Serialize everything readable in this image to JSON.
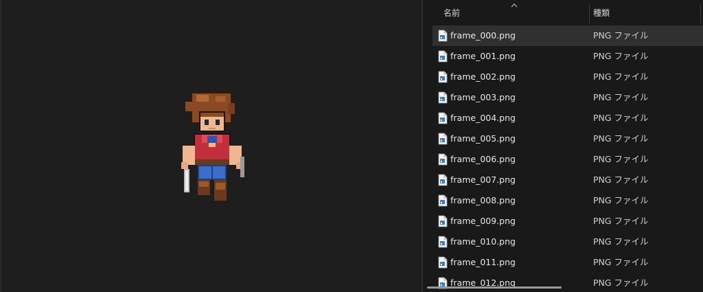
{
  "explorer": {
    "columns": {
      "name": "名前",
      "type": "種類"
    },
    "sort_icon": "chevron-up-icon",
    "file_icon": "png-file-icon",
    "files": [
      {
        "name": "frame_000.png",
        "type": "PNG ファイル"
      },
      {
        "name": "frame_001.png",
        "type": "PNG ファイル"
      },
      {
        "name": "frame_002.png",
        "type": "PNG ファイル"
      },
      {
        "name": "frame_003.png",
        "type": "PNG ファイル"
      },
      {
        "name": "frame_004.png",
        "type": "PNG ファイル"
      },
      {
        "name": "frame_005.png",
        "type": "PNG ファイル"
      },
      {
        "name": "frame_006.png",
        "type": "PNG ファイル"
      },
      {
        "name": "frame_007.png",
        "type": "PNG ファイル"
      },
      {
        "name": "frame_008.png",
        "type": "PNG ファイル"
      },
      {
        "name": "frame_009.png",
        "type": "PNG ファイル"
      },
      {
        "name": "frame_010.png",
        "type": "PNG ファイル"
      },
      {
        "name": "frame_011.png",
        "type": "PNG ファイル"
      },
      {
        "name": "frame_012.png",
        "type": "PNG ファイル"
      }
    ],
    "selected_index": 0
  },
  "colors": {
    "preview_bg": "#1e1e1e",
    "explorer_bg": "#191919",
    "selected_row": "#303030",
    "text": "#e8e8e8"
  }
}
